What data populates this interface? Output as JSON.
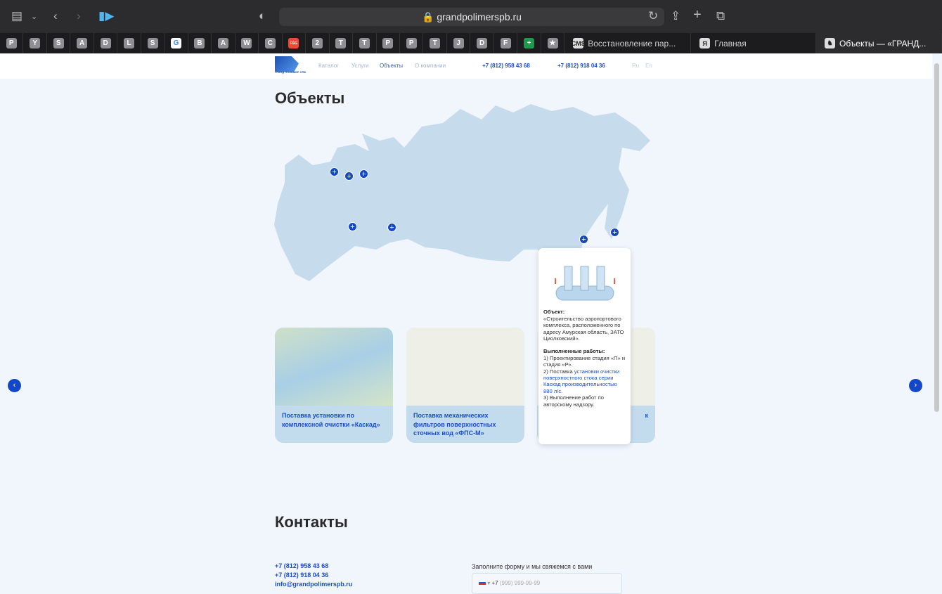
{
  "browser": {
    "url": "grandpolimerspb.ru",
    "favorites": [
      "P",
      "Y",
      "S",
      "A",
      "D",
      "L",
      "S",
      "G",
      "B",
      "A",
      "W",
      "C",
      "FSG",
      "2",
      "T",
      "T",
      "P",
      "P",
      "T",
      "J",
      "D",
      "F",
      "+",
      "★"
    ],
    "tabs": [
      {
        "icon": "CMS",
        "title": "Восстановление пар..."
      },
      {
        "icon": "Я",
        "title": "Главная"
      },
      {
        "icon": "♞",
        "title": "Объекты — «ГРАНД..."
      }
    ]
  },
  "header": {
    "nav": [
      "Каталог",
      "Услуги",
      "Объекты",
      "О компании"
    ],
    "phones": [
      "+7 (812) 958 43 68",
      "+7 (812) 918 04 36"
    ],
    "langs": [
      "Ru",
      "En"
    ],
    "logo_text": "ГРАНД ПОЛИМЕР СПБ"
  },
  "objects": {
    "title": "Объекты",
    "pin_symbol": "+",
    "cards": [
      {
        "title": "Поставка установки по комплексной очистки «Каскад»"
      },
      {
        "title": "Поставка механических фильтров поверхностных сточных вод «ФПС-М»"
      },
      {
        "title": "к"
      }
    ],
    "tooltip": {
      "object_label": "Объект:",
      "object_text": "«Строительство аэропортового комплекса, расположенного по адресу Амурская область, ЗАТО Циолковский».",
      "works_label": "Выполненные работы:",
      "work1": "1) Проектирование стадия «П» и стадия «Р».",
      "work2_prefix": "2) Поставка ",
      "work2_link": "установки очистки поверхностного стока серии Каскад производительностью 880 л/с.",
      "work3": "3) Выполнение работ по авторскому надзору."
    }
  },
  "contacts": {
    "title": "Контакты",
    "phones": [
      "+7 (812) 958 43 68",
      "+7 (812) 918 04 36"
    ],
    "email": "info@grandpolimerspb.ru",
    "form_label": "Заполните форму и мы свяжемся с вами",
    "phone_prefix": "+7",
    "phone_placeholder": "(999) 999-99-99"
  }
}
